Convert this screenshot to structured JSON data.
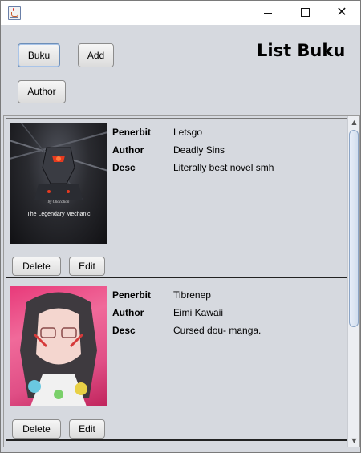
{
  "window": {
    "title": "",
    "controls": {
      "minimize_icon": "minimize-icon",
      "maximize_icon": "maximize-icon",
      "close_glyph": "✕"
    }
  },
  "toolbar": {
    "buku_label": "Buku",
    "add_label": "Add",
    "author_label": "Author"
  },
  "page": {
    "title": "List Buku"
  },
  "fields": {
    "penerbit": "Penerbit",
    "author": "Author",
    "desc": "Desc"
  },
  "books": [
    {
      "cover_text": "The Legendary Mechanic",
      "cover_sub": "by Chocolion",
      "penerbit": "Letsgo",
      "author": "Deadly Sins",
      "desc": "Literally best novel smh",
      "delete_label": "Delete",
      "edit_label": "Edit"
    },
    {
      "penerbit": "Tibrenep",
      "author": "Eimi Kawaii",
      "desc": "Cursed dou- manga.",
      "delete_label": "Delete",
      "edit_label": "Edit"
    }
  ],
  "scrollbar": {
    "up_glyph": "▲",
    "down_glyph": "▼"
  },
  "colors": {
    "window_bg": "#d6d9df",
    "focus_border": "#6d8fb8"
  }
}
